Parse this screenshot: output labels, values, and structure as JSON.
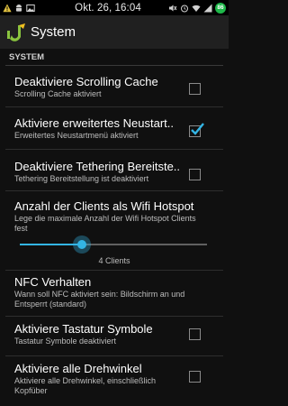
{
  "statusbar": {
    "clock": "Okt. 26, 16:04",
    "battery": "86",
    "icons_left": [
      "warning-icon",
      "android-icon",
      "image-icon"
    ],
    "icons_right": [
      "volume-mute-icon",
      "alarm-icon",
      "wifi-icon",
      "signal-icon",
      "battery-icon"
    ]
  },
  "actionbar": {
    "title": "System",
    "logo": "app-logo"
  },
  "section": {
    "header": "SYSTEM"
  },
  "prefs": [
    {
      "title": "Deaktiviere Scrolling Cache",
      "summary": "Scrolling Cache aktiviert",
      "checked": false
    },
    {
      "title": "Aktiviere erweitertes Neustart..",
      "summary": "Erweitertes Neustartmenü aktiviert",
      "checked": true
    },
    {
      "title": "Deaktiviere Tethering Bereitste..",
      "summary": "Tethering Bereitstellung ist deaktiviert",
      "checked": false
    },
    {
      "title": "Anzahl der Clients als Wifi Hotspot",
      "summary": "Lege die maximale Anzahl der Wifi Hotspot Clients fest"
    },
    {
      "title": "NFC Verhalten",
      "summary": "Wann soll NFC aktiviert sein: Bildschirm an und Entsperrt (standard)"
    },
    {
      "title": "Aktiviere Tastatur Symbole",
      "summary": "Tastatur Symbole deaktiviert",
      "checked": false
    },
    {
      "title": "Aktiviere alle Drehwinkel",
      "summary": "Aktiviere alle Drehwinkel, einschließlich Kopfüber",
      "checked": false
    }
  ],
  "hotspot_slider": {
    "value_label": "4 Clients",
    "fraction": 0.33
  },
  "colors": {
    "accent": "#33b5e5",
    "battery": "#1fb84a",
    "background": "#101010"
  }
}
